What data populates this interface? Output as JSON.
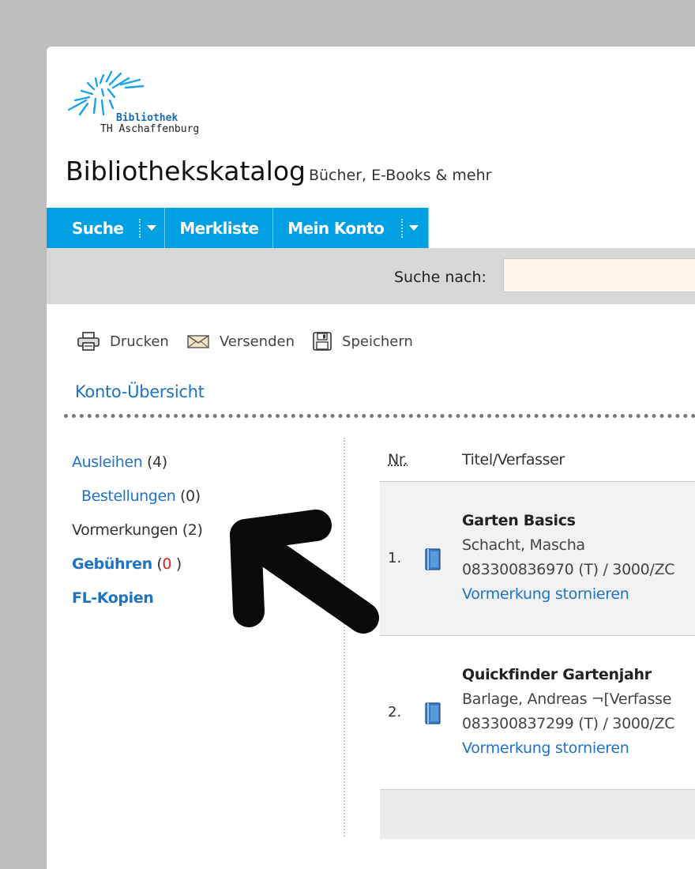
{
  "logo": {
    "line1": "Bibliothek",
    "line2": "TH Aschaffenburg"
  },
  "header": {
    "title": "Bibliothekskatalog",
    "subtitle": "Bücher, E-Books & mehr"
  },
  "nav": {
    "search": "Suche",
    "watchlist": "Merkliste",
    "account": "Mein Konto"
  },
  "search": {
    "label": "Suche nach:",
    "value": ""
  },
  "toolbar": {
    "print": "Drucken",
    "send": "Versenden",
    "save": "Speichern"
  },
  "section_title": "Konto-Übersicht",
  "sidebar": {
    "loans": {
      "label": "Ausleihen",
      "count": "(4)"
    },
    "orders": {
      "label": "Bestellungen",
      "count": "(0)"
    },
    "reservations": {
      "label": "Vormerkungen (2)"
    },
    "fees": {
      "label": "Gebühren",
      "open": "(",
      "value": "0",
      "close": " )"
    },
    "copies": {
      "label": "FL-Kopien"
    }
  },
  "table": {
    "col_nr": "Nr.",
    "col_title": "Titel/Verfasser",
    "rows": [
      {
        "nr": "1.",
        "title": "Garten Basics",
        "author": "Schacht, Mascha",
        "signature": "083300836970 (T) / 3000/ZC",
        "action": "Vormerkung stornieren"
      },
      {
        "nr": "2.",
        "title": "Quickfinder Gartenjahr",
        "author": "Barlage, Andreas ¬[Verfasse",
        "signature": "083300837299 (T) / 3000/ZC",
        "action": "Vormerkung stornieren"
      }
    ]
  },
  "colors": {
    "nav_blue": "#00a0e3",
    "link_blue": "#1f73c4",
    "search_bg": "#d8d8d8",
    "input_bg": "#fdf6e8",
    "alert_red": "#d42020",
    "backdrop": "#bdbdbd"
  }
}
